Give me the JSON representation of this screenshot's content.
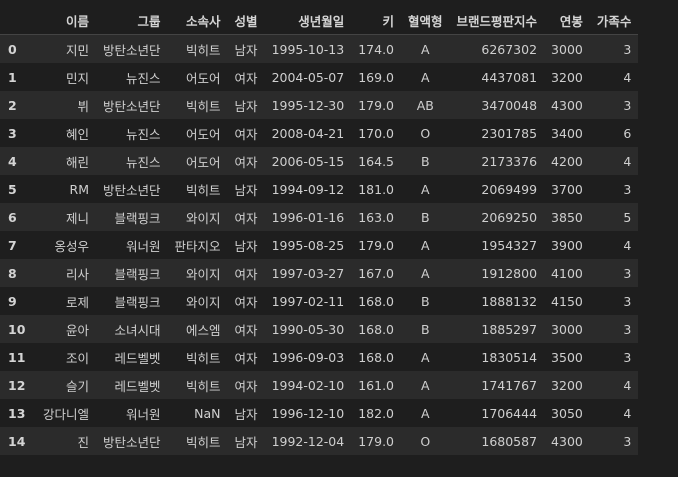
{
  "columns": [
    "이름",
    "그룹",
    "소속사",
    "성별",
    "생년월일",
    "키",
    "혈액형",
    "브랜드평판지수",
    "연봉",
    "가족수"
  ],
  "rows": [
    {
      "index": "0",
      "cells": [
        "지민",
        "방탄소년단",
        "빅히트",
        "남자",
        "1995-10-13",
        "174.0",
        "A",
        "6267302",
        "3000",
        "3"
      ]
    },
    {
      "index": "1",
      "cells": [
        "민지",
        "뉴진스",
        "어도어",
        "여자",
        "2004-05-07",
        "169.0",
        "A",
        "4437081",
        "3200",
        "4"
      ]
    },
    {
      "index": "2",
      "cells": [
        "뷔",
        "방탄소년단",
        "빅히트",
        "남자",
        "1995-12-30",
        "179.0",
        "AB",
        "3470048",
        "4300",
        "3"
      ]
    },
    {
      "index": "3",
      "cells": [
        "혜인",
        "뉴진스",
        "어도어",
        "여자",
        "2008-04-21",
        "170.0",
        "O",
        "2301785",
        "3400",
        "6"
      ]
    },
    {
      "index": "4",
      "cells": [
        "해린",
        "뉴진스",
        "어도어",
        "여자",
        "2006-05-15",
        "164.5",
        "B",
        "2173376",
        "4200",
        "4"
      ]
    },
    {
      "index": "5",
      "cells": [
        "RM",
        "방탄소년단",
        "빅히트",
        "남자",
        "1994-09-12",
        "181.0",
        "A",
        "2069499",
        "3700",
        "3"
      ]
    },
    {
      "index": "6",
      "cells": [
        "제니",
        "블랙핑크",
        "와이지",
        "여자",
        "1996-01-16",
        "163.0",
        "B",
        "2069250",
        "3850",
        "5"
      ]
    },
    {
      "index": "7",
      "cells": [
        "옹성우",
        "워너원",
        "판타지오",
        "남자",
        "1995-08-25",
        "179.0",
        "A",
        "1954327",
        "3900",
        "4"
      ]
    },
    {
      "index": "8",
      "cells": [
        "리사",
        "블랙핑크",
        "와이지",
        "여자",
        "1997-03-27",
        "167.0",
        "A",
        "1912800",
        "4100",
        "3"
      ]
    },
    {
      "index": "9",
      "cells": [
        "로제",
        "블랙핑크",
        "와이지",
        "여자",
        "1997-02-11",
        "168.0",
        "B",
        "1888132",
        "4150",
        "3"
      ]
    },
    {
      "index": "10",
      "cells": [
        "윤아",
        "소녀시대",
        "에스엠",
        "여자",
        "1990-05-30",
        "168.0",
        "B",
        "1885297",
        "3000",
        "3"
      ]
    },
    {
      "index": "11",
      "cells": [
        "조이",
        "레드벨벳",
        "빅히트",
        "여자",
        "1996-09-03",
        "168.0",
        "A",
        "1830514",
        "3500",
        "3"
      ]
    },
    {
      "index": "12",
      "cells": [
        "슬기",
        "레드벨벳",
        "빅히트",
        "여자",
        "1994-02-10",
        "161.0",
        "A",
        "1741767",
        "3200",
        "4"
      ]
    },
    {
      "index": "13",
      "cells": [
        "강다니엘",
        "워너원",
        "NaN",
        "남자",
        "1996-12-10",
        "182.0",
        "A",
        "1706444",
        "3050",
        "4"
      ]
    },
    {
      "index": "14",
      "cells": [
        "진",
        "방탄소년단",
        "빅히트",
        "남자",
        "1992-12-04",
        "179.0",
        "O",
        "1680587",
        "4300",
        "3"
      ]
    }
  ]
}
